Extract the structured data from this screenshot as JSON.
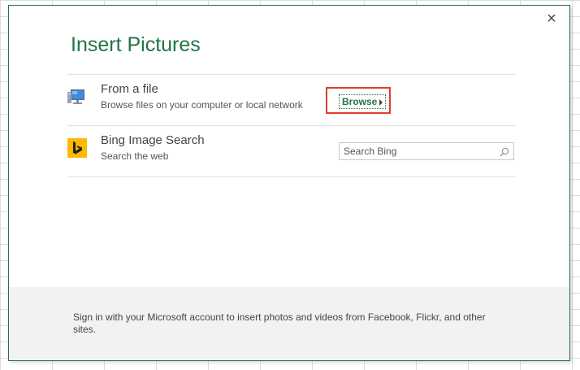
{
  "dialog": {
    "title": "Insert Pictures",
    "close_label": "×",
    "from_file": {
      "title": "From a file",
      "description": "Browse files on your computer or local network",
      "browse_label": "Browse",
      "icon": "computer-icon"
    },
    "bing": {
      "title": "Bing Image Search",
      "description": "Search the web",
      "search_placeholder": "Search Bing",
      "search_value": "",
      "icon": "bing-logo-icon",
      "brand_color": "#ffb900"
    },
    "footer_text": "Sign in with your Microsoft account to insert photos and videos from Facebook, Flickr, and other sites."
  },
  "colors": {
    "accent": "#217346",
    "highlight": "#e03c31"
  }
}
